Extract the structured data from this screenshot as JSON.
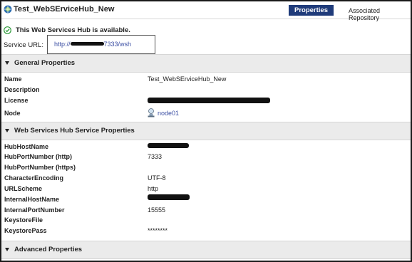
{
  "header": {
    "service_name": "Test_WebSErviceHub_New",
    "tabs": [
      {
        "label": "Properties",
        "active": true
      },
      {
        "label": "Associated Repository",
        "active": false
      }
    ]
  },
  "status": {
    "message": "This Web Services Hub is available.",
    "icon": "check-circle-icon"
  },
  "service_url": {
    "label": "Service URL:",
    "prefix": "http://",
    "suffix": "7333/wsh"
  },
  "sections": [
    {
      "title": "General Properties",
      "expanded": true
    },
    {
      "title": "Web Services Hub Service Properties",
      "expanded": true
    },
    {
      "title": "Advanced Properties",
      "expanded": false
    }
  ],
  "general": {
    "name_label": "Name",
    "name_value": "Test_WebSErviceHub_New",
    "description_label": "Description",
    "license_label": "License",
    "node_label": "Node",
    "node_value": "node01"
  },
  "hub_props": {
    "hosthname_label": "HubHostName",
    "port_http_label": "HubPortNumber (http)",
    "port_http_value": "7333",
    "port_https_label": "HubPortNumber (https)",
    "encoding_label": "CharacterEncoding",
    "encoding_value": "UTF-8",
    "urlscheme_label": "URLScheme",
    "urlscheme_value": "http",
    "internal_host_label": "InternalHostName",
    "internal_port_label": "InternalPortNumber",
    "internal_port_value": "15555",
    "keystore_file_label": "KeystoreFile",
    "keystore_pass_label": "KeystorePass",
    "keystore_pass_value": "********"
  },
  "colors": {
    "active_tab": "#1f3b7a",
    "link": "#3b4ea3",
    "section_bg": "#ebebeb",
    "check_green": "#2e9a3a"
  }
}
